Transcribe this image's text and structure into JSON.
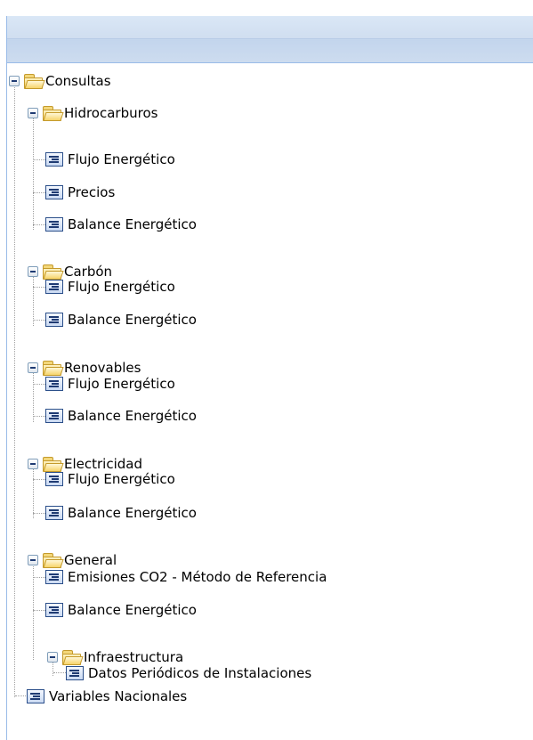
{
  "tree": {
    "root": "Consultas",
    "hidrocarburos": {
      "label": "Hidrocarburos",
      "items": [
        "Flujo Energético",
        "Precios",
        "Balance Energético"
      ]
    },
    "carbon": {
      "label": "Carbón",
      "items": [
        "Flujo Energético",
        "Balance Energético"
      ]
    },
    "renovables": {
      "label": "Renovables",
      "items": [
        "Flujo Energético",
        "Balance Energético"
      ]
    },
    "electricidad": {
      "label": "Electricidad",
      "items": [
        "Flujo Energético",
        "Balance Energético"
      ]
    },
    "general": {
      "label": "General",
      "items": [
        "Emisiones CO2 - Método de Referencia",
        "Balance Energético"
      ],
      "infraestructura": {
        "label": "Infraestructura",
        "items": [
          "Datos Periódicos de Instalaciones"
        ]
      }
    },
    "variables": "Variables Nacionales"
  },
  "icons": {
    "expanded": "minus-box-icon",
    "folder": "folder-open-icon",
    "leaf": "document-lines-icon"
  }
}
